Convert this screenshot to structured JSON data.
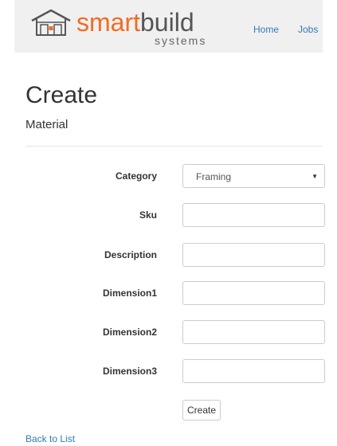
{
  "brand": {
    "name_part1": "smart",
    "name_part2": "build",
    "tagline": "systems",
    "colors": {
      "orange": "#f26b21",
      "gray": "#555555"
    }
  },
  "nav": {
    "items": [
      {
        "label": "Home"
      },
      {
        "label": "Jobs"
      }
    ],
    "link_color": "#337ab7"
  },
  "page": {
    "title": "Create",
    "subtitle": "Material"
  },
  "form": {
    "category": {
      "label": "Category",
      "selected": "Framing"
    },
    "fields": [
      {
        "label": "Sku",
        "value": ""
      },
      {
        "label": "Description",
        "value": ""
      },
      {
        "label": "Dimension1",
        "value": ""
      },
      {
        "label": "Dimension2",
        "value": ""
      },
      {
        "label": "Dimension3",
        "value": ""
      }
    ],
    "submit_label": "Create"
  },
  "footer": {
    "back_link": "Back to List"
  }
}
